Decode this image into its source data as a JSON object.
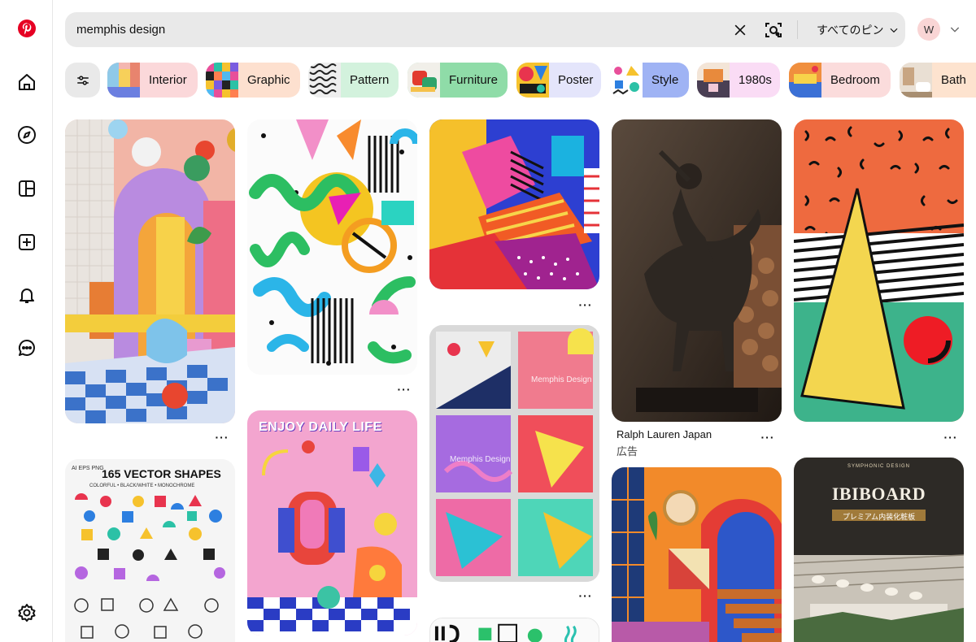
{
  "search": {
    "value": "memphis design",
    "filter_label": "すべてのピン"
  },
  "user": {
    "initial": "W"
  },
  "sidebar": {
    "items": [
      {
        "name": "home"
      },
      {
        "name": "explore"
      },
      {
        "name": "boards"
      },
      {
        "name": "create"
      },
      {
        "name": "notifications"
      },
      {
        "name": "messages"
      },
      {
        "name": "settings"
      }
    ]
  },
  "chips": [
    {
      "label": "Interior",
      "color": "#fbd8da"
    },
    {
      "label": "Graphic",
      "color": "#fde0cf"
    },
    {
      "label": "Pattern",
      "color": "#d3f2dd"
    },
    {
      "label": "Furniture",
      "color": "#8fdca8"
    },
    {
      "label": "Poster",
      "color": "#e4e5fb"
    },
    {
      "label": "Style",
      "color": "#9fb3f4"
    },
    {
      "label": "1980s",
      "color": "#fadcf5"
    },
    {
      "label": "Bedroom",
      "color": "#fbdcdc"
    },
    {
      "label": "Bath",
      "color": "#fde3cf"
    }
  ],
  "pins": {
    "ad": {
      "title": "Ralph Lauren Japan",
      "sub": "広告"
    },
    "poster_enjoy": {
      "text": "ENJOY DAILY LIFE"
    },
    "vector_shapes": {
      "title": "165 VECTOR SHAPES",
      "tag": "AI EPS PNG",
      "sub": "COLORFUL • BLACK/WHITE • MONOCHROME"
    },
    "board_ad": {
      "brand": "IBIBOARD",
      "sub": "プレミアム内装化粧板",
      "top": "SYMPHONIC DESIGN"
    },
    "memphis_cards": {
      "label": "Memphis Design"
    }
  },
  "more_label": "···"
}
